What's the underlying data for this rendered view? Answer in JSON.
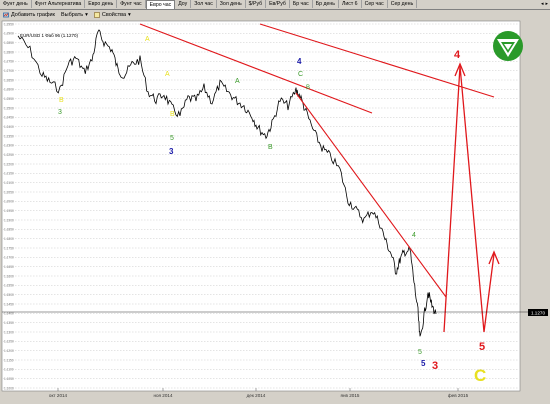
{
  "tabs": [
    {
      "label": "Фунт день",
      "active": false
    },
    {
      "label": "Фунт Альтернатива",
      "active": false
    },
    {
      "label": "Евро день",
      "active": false
    },
    {
      "label": "Фунт час",
      "active": false
    },
    {
      "label": "Евро час",
      "active": true
    },
    {
      "label": "Доу",
      "active": false
    },
    {
      "label": "Зол час",
      "active": false
    },
    {
      "label": "Зол день",
      "active": false
    },
    {
      "label": "$/Руб",
      "active": false
    },
    {
      "label": "Ев/Руб",
      "active": false
    },
    {
      "label": "Бр час",
      "active": false
    },
    {
      "label": "Бр день",
      "active": false
    },
    {
      "label": "Лист 6",
      "active": false
    },
    {
      "label": "Сер час",
      "active": false
    },
    {
      "label": "Сер день",
      "active": false
    }
  ],
  "toolbar": {
    "add_chart": "Добавить график",
    "select": "Выбрать",
    "properties": "Свойства"
  },
  "chart": {
    "legend": "EUR/USD 1 Фаб 96 (1.1270)",
    "price_label": "1.1270",
    "x_ticks": [
      "окт 2014",
      "ноя 2014",
      "дек 2014",
      "янв 2015",
      "фев 2015"
    ],
    "y_ticks": [
      "1.2950",
      "1.2900",
      "1.2850",
      "1.2800",
      "1.2750",
      "1.2700",
      "1.2650",
      "1.2600",
      "1.2550",
      "1.2500",
      "1.2450",
      "1.2400",
      "1.2350",
      "1.2300",
      "1.2250",
      "1.2200",
      "1.2150",
      "1.2100",
      "1.2050",
      "1.2000",
      "1.1950",
      "1.1900",
      "1.1850",
      "1.1800",
      "1.1750",
      "1.1700",
      "1.1650",
      "1.1600",
      "1.1550",
      "1.1500",
      "1.1450",
      "1.1400",
      "1.1350",
      "1.1300",
      "1.1250",
      "1.1200",
      "1.1150",
      "1.1100",
      "1.1050",
      "1.1000"
    ],
    "labels": {
      "l_a1": "A",
      "l_b1": "B",
      "l_3g": "3",
      "l_a2": "A",
      "l_b2": "B",
      "l_5g": "5",
      "l_3b": "3",
      "l_a3": "A",
      "l_b3": "B",
      "l_4b": "4",
      "l_c": "C",
      "l_bsmall": "B",
      "l_4g": "4",
      "l_5small": "5",
      "l_5b": "5",
      "l_3r": "3",
      "l_4r": "4",
      "l_5r": "5",
      "l_cy": "C"
    },
    "colors": {
      "background": "#ffffff",
      "line": "#000000",
      "trend": "#e0181c",
      "grid": "#b8b8b8",
      "green": "#3a9a2a",
      "blue": "#1a1aa8",
      "red": "#e0181c",
      "yellow": "#e8e020"
    }
  }
}
